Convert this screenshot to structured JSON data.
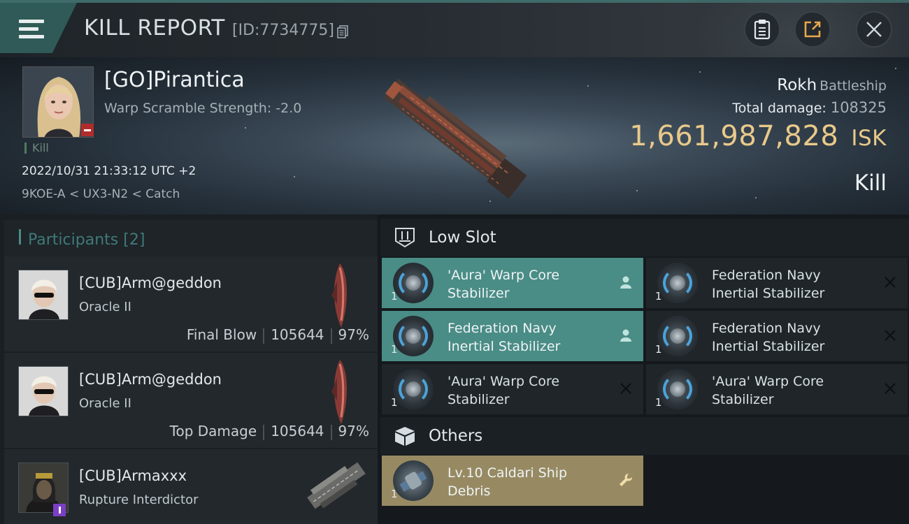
{
  "header": {
    "title": "KILL REPORT",
    "report_id": "[ID:7734775]"
  },
  "victim": {
    "name": "[GO]Pirantica",
    "warp_scramble": "Warp Scramble Strength: -2.0",
    "kill_tag": "Kill",
    "timestamp": "2022/10/31 21:33:12 UTC +2",
    "location": "9KOE-A < UX3-N2 < Catch",
    "ship_name": "Rokh",
    "ship_class": "Battleship",
    "total_damage_label": "Total damage:",
    "total_damage": "108325",
    "isk_value": "1,661,987,828",
    "isk_unit": "ISK",
    "outcome": "Kill"
  },
  "participants": {
    "title": "Participants",
    "count": "[2]",
    "items": [
      {
        "name": "[CUB]Arm@geddon",
        "ship": "Oracle II",
        "role": "Final Blow",
        "damage": "105644",
        "percent": "97%"
      },
      {
        "name": "[CUB]Arm@geddon",
        "ship": "Oracle II",
        "role": "Top Damage",
        "damage": "105644",
        "percent": "97%"
      },
      {
        "name": "[CUB]Armaxxx",
        "ship": "Rupture Interdictor"
      }
    ]
  },
  "low_slot": {
    "title": "Low Slot",
    "items": [
      {
        "qty": "1",
        "line1": "'Aura' Warp Core",
        "line2": "Stabilizer",
        "status": "dropped"
      },
      {
        "qty": "1",
        "line1": "Federation Navy",
        "line2": "Inertial Stabilizer",
        "status": "destroyed"
      },
      {
        "qty": "1",
        "line1": "Federation Navy",
        "line2": "Inertial Stabilizer",
        "status": "dropped"
      },
      {
        "qty": "1",
        "line1": "Federation Navy",
        "line2": "Inertial Stabilizer",
        "status": "destroyed"
      },
      {
        "qty": "1",
        "line1": "'Aura' Warp Core",
        "line2": "Stabilizer",
        "status": "destroyed"
      },
      {
        "qty": "1",
        "line1": "'Aura' Warp Core",
        "line2": "Stabilizer",
        "status": "destroyed"
      }
    ]
  },
  "others": {
    "title": "Others",
    "items": [
      {
        "qty": "1",
        "line1": "Lv.10 Caldari Ship",
        "line2": "Debris",
        "status": "salvage"
      }
    ]
  },
  "colors": {
    "accent_teal": "#4a8c86",
    "isk_gold": "#e9c98a",
    "debris_gold": "#978a63",
    "negative_badge": "#b22b2b"
  }
}
